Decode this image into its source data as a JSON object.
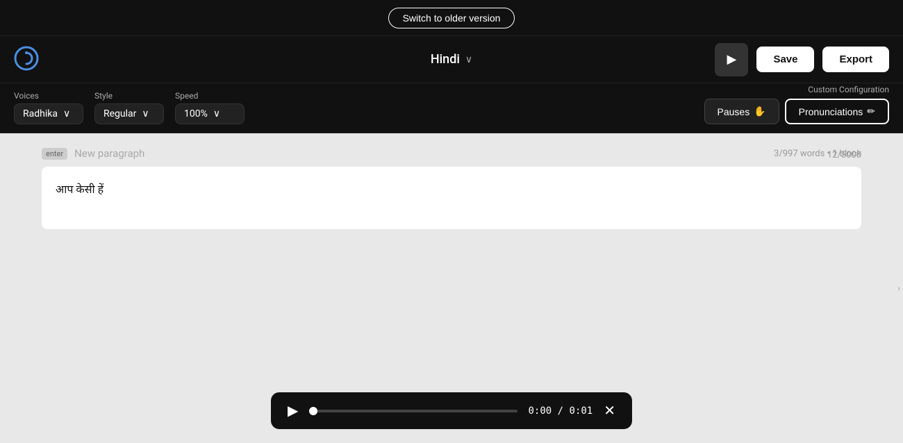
{
  "banner": {
    "switch_label": "Switch to older version"
  },
  "header": {
    "language": "Hindi",
    "save_label": "Save",
    "export_label": "Export"
  },
  "controls": {
    "voices_label": "Voices",
    "voices_value": "Radhika",
    "style_label": "Style",
    "style_value": "Regular",
    "speed_label": "Speed",
    "speed_value": "100%",
    "custom_config_label": "Custom Configuration",
    "pauses_label": "Pauses",
    "pronunciations_label": "Pronunciations"
  },
  "editor": {
    "new_paragraph_placeholder": "New paragraph",
    "enter_badge": "enter",
    "word_count": "3/997 words • 1 block",
    "text_content": "आप केसी हें",
    "char_count": "12/5000"
  },
  "player": {
    "time_current": "0:00",
    "time_total": "0:01"
  },
  "icons": {
    "play_triangle": "▶",
    "chevron_down": "∨",
    "close_x": "✕",
    "hand_icon": "✋",
    "pencil_icon": "✏"
  }
}
